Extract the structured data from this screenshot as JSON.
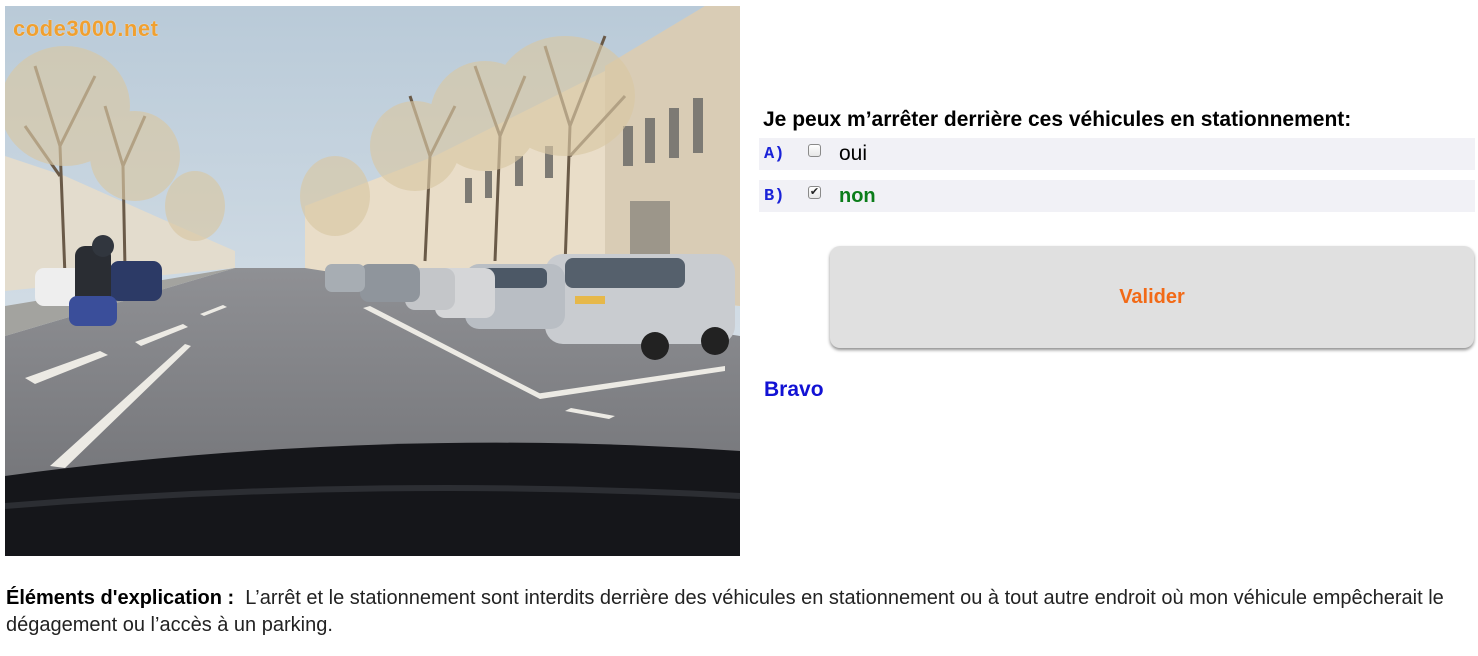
{
  "image": {
    "watermark": "code3000.net"
  },
  "quiz": {
    "question": "Je peux m’arrêter derrière ces véhicules en stationnement:",
    "options": [
      {
        "letter": "A)",
        "text": "oui",
        "checked": false
      },
      {
        "letter": "B)",
        "text": "non",
        "checked": true
      }
    ],
    "validate_label": "Valider",
    "feedback": "Bravo"
  },
  "explanation": {
    "label": "Éléments d'explication :",
    "text": "L’arrêt et le stationnement sont interdits derrière des véhicules en stationnement ou à tout autre endroit où mon véhicule empêcherait le dégagement ou l’accès à un parking."
  },
  "colors": {
    "option_letter": "#1a22d8",
    "correct_answer": "#0b7d1a",
    "validate_text": "#f26a17",
    "feedback": "#1212d4",
    "watermark": "#f0a030"
  },
  "icons": [
    "checkbox-icon",
    "check-icon"
  ]
}
